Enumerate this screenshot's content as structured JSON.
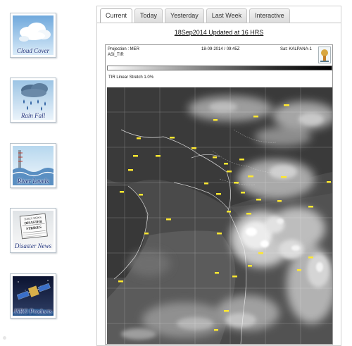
{
  "sidebar": {
    "items": [
      {
        "label": "Cloud Cover",
        "icon": "cloud-icon"
      },
      {
        "label": "Rain Fall",
        "icon": "rain-icon"
      },
      {
        "label": "River Levels",
        "icon": "river-icon"
      },
      {
        "label": "Disaster News",
        "icon": "newspaper-icon"
      },
      {
        "label": "ISRO Products",
        "icon": "satellite-icon"
      }
    ],
    "news_headline": "DAILY NEWS\nDISASTER\nSTRIKES"
  },
  "tabs": [
    {
      "label": "Current",
      "active": true
    },
    {
      "label": "Today",
      "active": false
    },
    {
      "label": "Yesterday",
      "active": false
    },
    {
      "label": "Last Week",
      "active": false
    },
    {
      "label": "Interactive",
      "active": false
    }
  ],
  "update_title": "18Sep2014 Updated at 16 HRS",
  "satellite_image": {
    "projection": "Projection : MER",
    "channel": "ASI_TIR",
    "datetime": "18-09-2014 / 09:45Z",
    "satellite": "Sat: KALPANA-1",
    "stretch": "TIR Linear Stretch 1.0%"
  },
  "colors": {
    "link_blue": "#1c2f7a",
    "label_yellow": "#ffe830",
    "tab_border": "#c4c4c4"
  }
}
